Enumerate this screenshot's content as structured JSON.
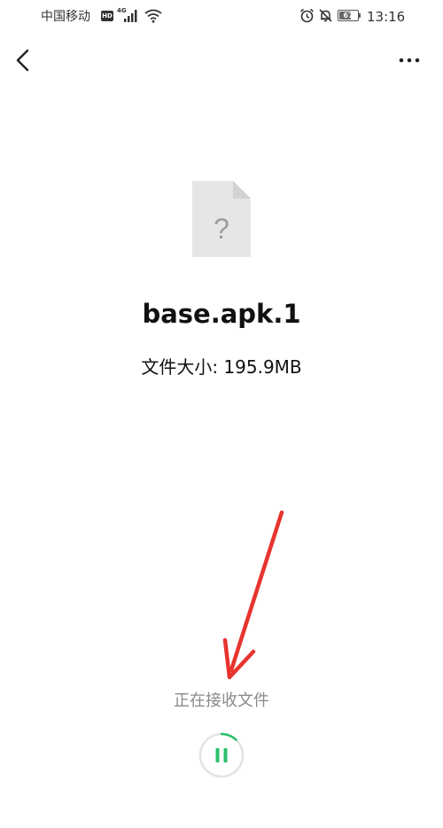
{
  "status_bar": {
    "carrier": "中国移动",
    "hd_badge": "HD",
    "network_type": "4G",
    "battery_level": "67",
    "battery_percent": 67,
    "time": "13:16"
  },
  "nav": {
    "back_icon": "chevron-left-icon",
    "more_icon": "more-horizontal-icon"
  },
  "file": {
    "icon": "unknown-file-icon",
    "icon_glyph": "?",
    "name": "base.apk.1",
    "size_label": "文件大小: 195.9MB"
  },
  "transfer": {
    "status_text": "正在接收文件",
    "progress_percent": 12,
    "pause_icon": "pause-icon"
  },
  "colors": {
    "accent_green": "#2bbf6a",
    "annotation_red": "#e8342e",
    "muted_text": "#8a8a8a",
    "file_icon_gray": "#e6e6e6"
  }
}
